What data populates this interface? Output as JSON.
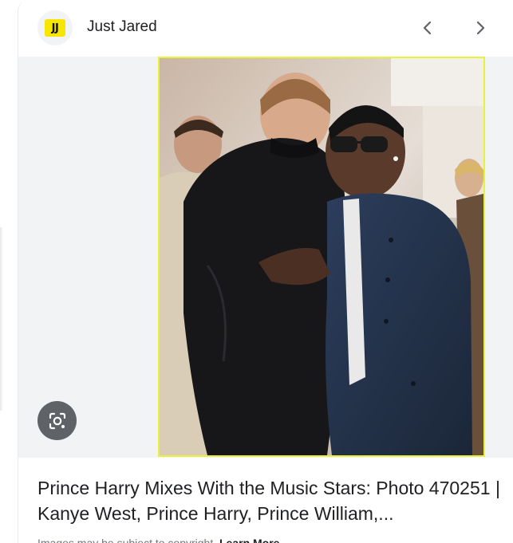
{
  "source": {
    "logo_text": "JJ",
    "logo_color": "#f7e600",
    "name": "Just Jared"
  },
  "navigation": {
    "prev_icon": "chevron-left-icon",
    "next_icon": "chevron-right-icon"
  },
  "image": {
    "highlight_color": "#e8f23a"
  },
  "lens": {
    "icon": "google-lens-icon"
  },
  "result": {
    "title": "Prince Harry Mixes With the Music Stars: Photo 470251 | Kanye West, Prince Harry, Prince William,...",
    "copyright_text": "Images may be subject to copyright.",
    "learn_more": "Learn More"
  }
}
